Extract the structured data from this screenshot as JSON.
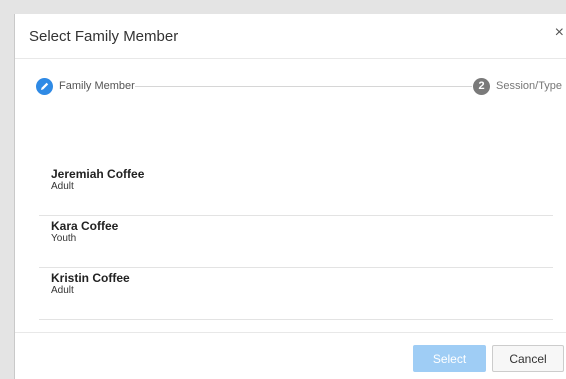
{
  "dialog": {
    "title": "Select Family Member",
    "close_glyph": "×"
  },
  "steps": [
    {
      "label": "Family Member",
      "icon": "pencil-icon",
      "state": "active"
    },
    {
      "number": "2",
      "label": "Session/Type",
      "state": "pending"
    }
  ],
  "members": [
    {
      "name": "Jeremiah Coffee",
      "role": "Adult"
    },
    {
      "name": "Kara Coffee",
      "role": "Youth"
    },
    {
      "name": "Kristin Coffee",
      "role": "Adult"
    }
  ],
  "footer": {
    "select_label": "Select",
    "cancel_label": "Cancel"
  },
  "colors": {
    "accent": "#2f8ae5",
    "select_disabled": "#9fcdf5",
    "step_pending": "#7a7a7a"
  }
}
